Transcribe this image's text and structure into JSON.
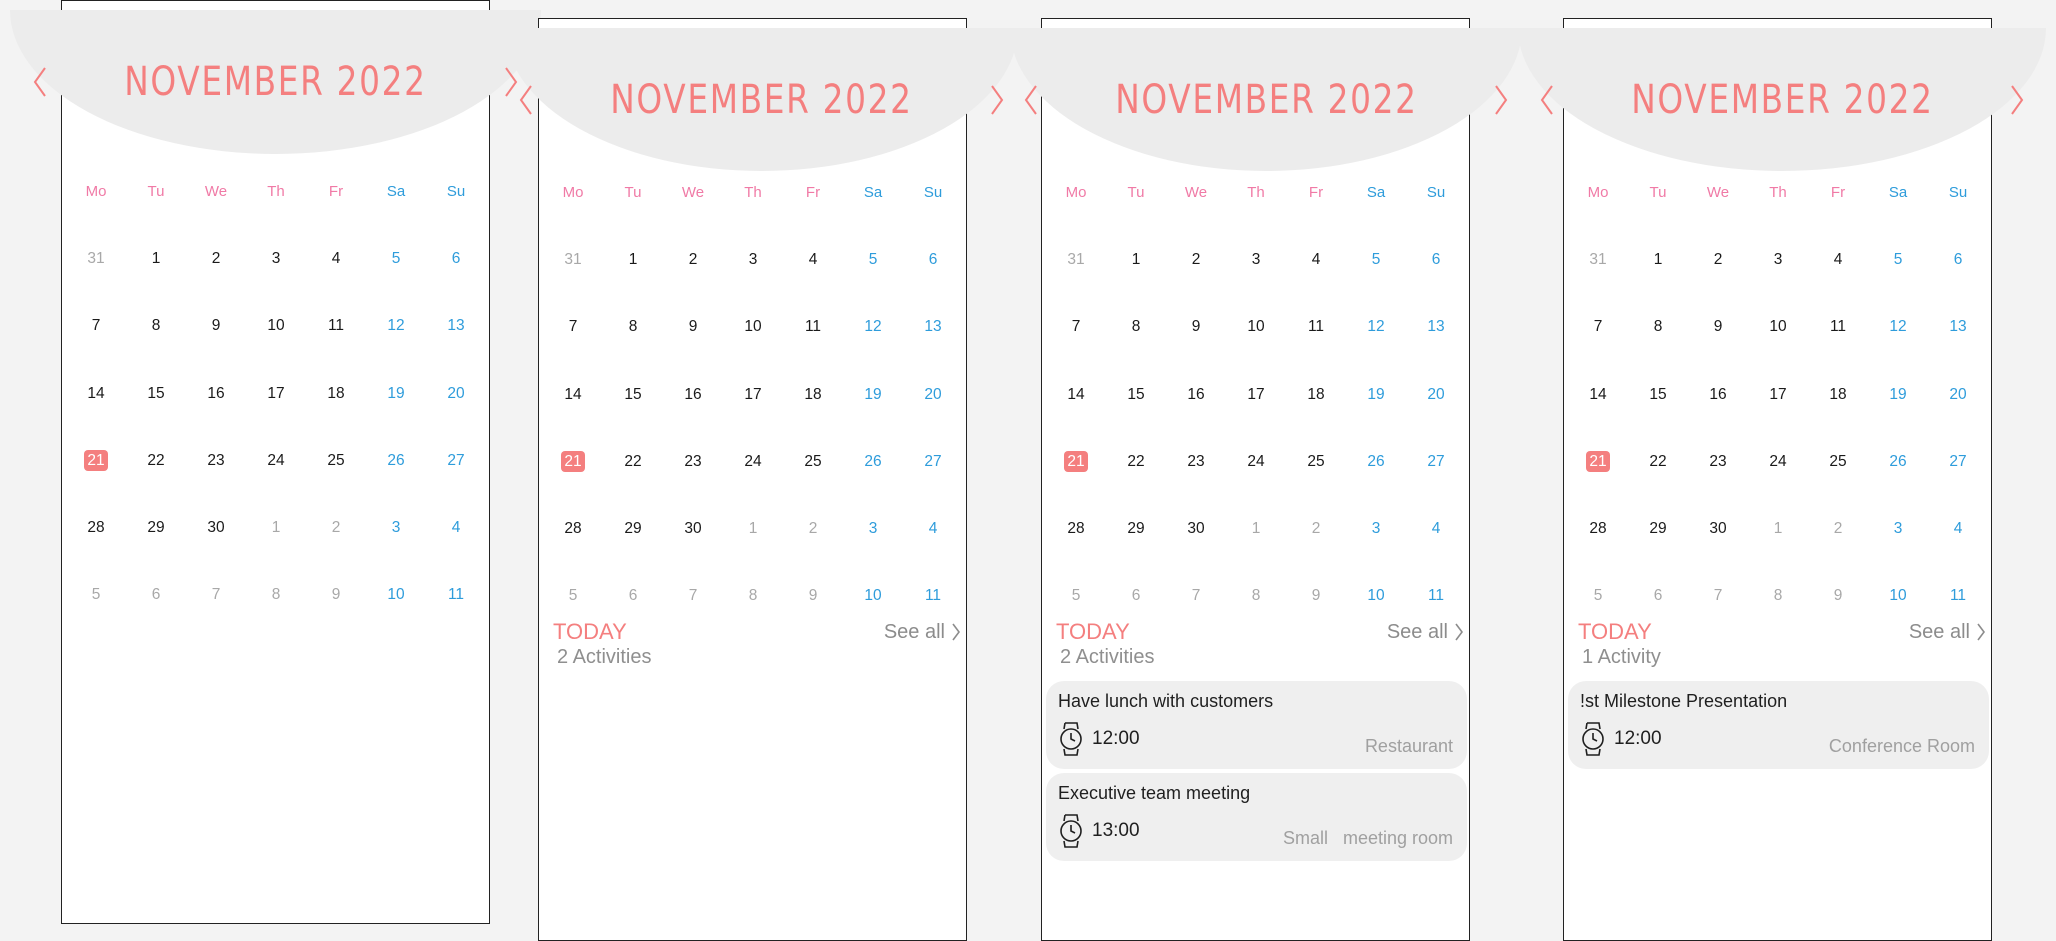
{
  "calendar": {
    "month_title": "NOVEMBER  2022",
    "weekdays": [
      "Mo",
      "Tu",
      "We",
      "Th",
      "Fr",
      "Sa",
      "Su"
    ],
    "weeks": [
      [
        "31",
        "1",
        "2",
        "3",
        "4",
        "5",
        "6"
      ],
      [
        "7",
        "8",
        "9",
        "10",
        "11",
        "12",
        "13"
      ],
      [
        "14",
        "15",
        "16",
        "17",
        "18",
        "19",
        "20"
      ],
      [
        "21",
        "22",
        "23",
        "24",
        "25",
        "26",
        "27"
      ],
      [
        "28",
        "29",
        "30",
        "1",
        "2",
        "3",
        "4"
      ],
      [
        "5",
        "6",
        "7",
        "8",
        "9",
        "10",
        "11"
      ]
    ],
    "today_day": "21",
    "colors": {
      "accent": "#f47f7f",
      "weekday": "#f07aa6",
      "weekend": "#2e9cdb",
      "muted": "#a8a8a8"
    }
  },
  "screens": [
    {},
    {
      "today_label": "TODAY",
      "see_all": "See all",
      "count": "2 Activities",
      "events": []
    },
    {
      "today_label": "TODAY",
      "see_all": "See all",
      "count": "2 Activities",
      "events": [
        {
          "title": "Have lunch with customers",
          "time": "12:00",
          "location": "Restaurant"
        },
        {
          "title": "Executive team meeting",
          "time": "13:00",
          "location": "Small   meeting room"
        }
      ]
    },
    {
      "today_label": "TODAY",
      "see_all": "See all",
      "count": "1 Activity",
      "events": [
        {
          "title": "!st Milestone Presentation",
          "time": "12:00",
          "location": "Conference Room"
        }
      ]
    }
  ]
}
